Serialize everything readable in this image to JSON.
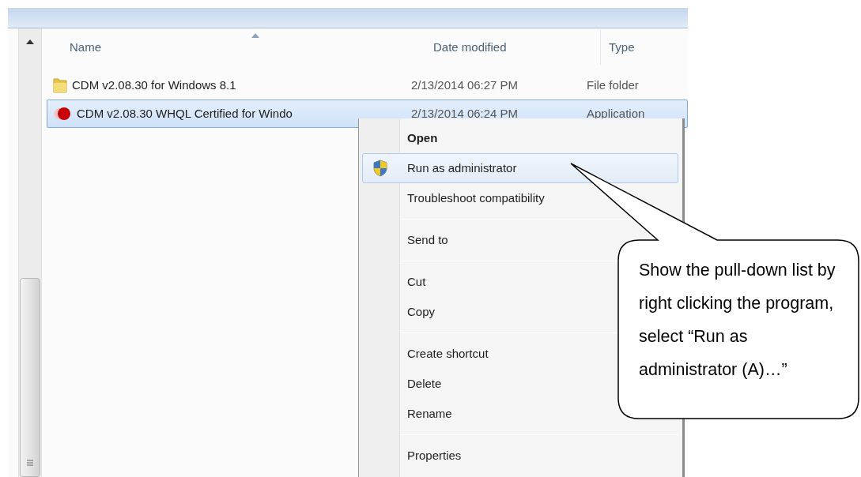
{
  "columns": [
    {
      "label": "Name",
      "sorted": true
    },
    {
      "label": "Date modified",
      "sorted": false
    },
    {
      "label": "Type",
      "sorted": false
    }
  ],
  "files": [
    {
      "kind": "folder",
      "name": "CDM v2.08.30 for Windows 8.1",
      "date": "2/13/2014 06:27 PM",
      "type": "File folder",
      "selected": false
    },
    {
      "kind": "application",
      "name": "CDM v2.08.30 WHQL Certified for Windo",
      "date": "2/13/2014 06:24 PM",
      "type": "Application",
      "selected": true
    }
  ],
  "context_menu": {
    "groups": [
      [
        {
          "label": "Open",
          "kind": "plain",
          "default": true,
          "selected": false
        },
        {
          "label": "Run as administrator",
          "kind": "shield",
          "default": false,
          "selected": true
        },
        {
          "label": "Troubleshoot compatibility",
          "kind": "plain",
          "default": false,
          "selected": false
        }
      ],
      [
        {
          "label": "Send to",
          "kind": "plain",
          "default": false,
          "selected": false
        }
      ],
      [
        {
          "label": "Cut",
          "kind": "plain",
          "default": false,
          "selected": false
        },
        {
          "label": "Copy",
          "kind": "plain",
          "default": false,
          "selected": false
        }
      ],
      [
        {
          "label": "Create shortcut",
          "kind": "plain",
          "default": false,
          "selected": false
        },
        {
          "label": "Delete",
          "kind": "plain",
          "default": false,
          "selected": false
        },
        {
          "label": "Rename",
          "kind": "plain",
          "default": false,
          "selected": false
        }
      ],
      [
        {
          "label": "Properties",
          "kind": "plain",
          "default": false,
          "selected": false
        }
      ]
    ]
  },
  "callout": {
    "text": "Show the pull-down list by right clicking the program, select “Run as administrator (A)…”"
  }
}
